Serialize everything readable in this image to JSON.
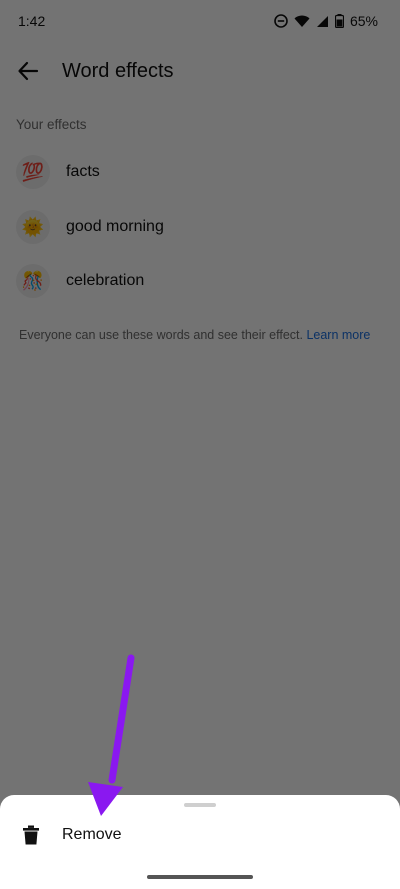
{
  "status_bar": {
    "time": "1:42",
    "battery": "65%",
    "icons": [
      "do-not-disturb-icon",
      "wifi-icon",
      "signal-icon",
      "battery-icon"
    ]
  },
  "app_bar": {
    "back_icon": "arrow-left-icon",
    "title": "Word effects"
  },
  "section": {
    "label": "Your effects"
  },
  "effects": [
    {
      "emoji": "💯",
      "label": "facts"
    },
    {
      "emoji": "🌞",
      "label": "good morning"
    },
    {
      "emoji": "🎊",
      "label": "celebration"
    }
  ],
  "footnote": {
    "text": "Everyone can use these words and see their effect.",
    "link": "Learn more"
  },
  "sheet": {
    "remove_label": "Remove",
    "remove_icon": "trash-icon"
  },
  "colors": {
    "link": "#1c6fe0",
    "scrim": "rgba(0,0,0,0.55)",
    "annotation_arrow": "#8a18f0"
  }
}
